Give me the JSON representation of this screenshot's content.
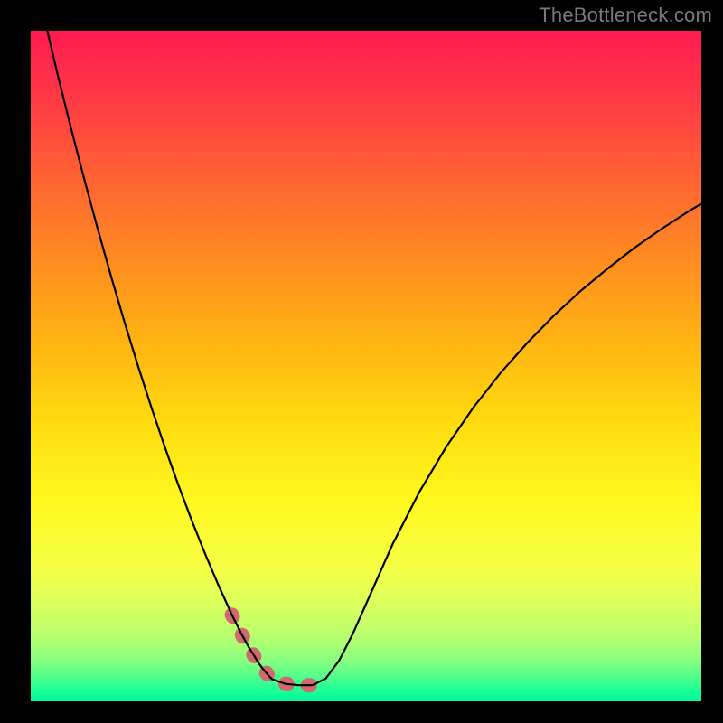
{
  "watermark": "TheBottleneck.com",
  "chart_data": {
    "type": "line",
    "title": "",
    "xlabel": "",
    "ylabel": "",
    "xlim": [
      0,
      1
    ],
    "ylim": [
      0,
      1
    ],
    "x": [
      0.0,
      0.02,
      0.04,
      0.06,
      0.08,
      0.1,
      0.12,
      0.14,
      0.16,
      0.18,
      0.2,
      0.22,
      0.24,
      0.26,
      0.28,
      0.3,
      0.305,
      0.31,
      0.315,
      0.32,
      0.325,
      0.33,
      0.335,
      0.34,
      0.345,
      0.35,
      0.355,
      0.36,
      0.38,
      0.4,
      0.42,
      0.44,
      0.46,
      0.48,
      0.5,
      0.54,
      0.58,
      0.62,
      0.66,
      0.7,
      0.74,
      0.78,
      0.82,
      0.86,
      0.9,
      0.94,
      0.98,
      1.0
    ],
    "y": [
      1.11,
      1.02,
      0.935,
      0.855,
      0.778,
      0.704,
      0.633,
      0.565,
      0.5,
      0.438,
      0.379,
      0.323,
      0.27,
      0.22,
      0.173,
      0.129,
      0.119,
      0.109,
      0.099,
      0.09,
      0.081,
      0.073,
      0.065,
      0.057,
      0.05,
      0.044,
      0.038,
      0.033,
      0.026,
      0.024,
      0.024,
      0.034,
      0.061,
      0.1,
      0.145,
      0.235,
      0.313,
      0.38,
      0.438,
      0.489,
      0.534,
      0.575,
      0.612,
      0.645,
      0.676,
      0.704,
      0.73,
      0.742
    ],
    "highlight_range": {
      "x_start": 0.3,
      "x_end": 0.44,
      "y_max": 0.13
    },
    "gradient_stops": [
      {
        "pos": 0.0,
        "color": "#ff1b50"
      },
      {
        "pos": 0.06,
        "color": "#ff2c4b"
      },
      {
        "pos": 0.14,
        "color": "#ff4640"
      },
      {
        "pos": 0.24,
        "color": "#ff6a30"
      },
      {
        "pos": 0.35,
        "color": "#ff8f20"
      },
      {
        "pos": 0.47,
        "color": "#ffb612"
      },
      {
        "pos": 0.59,
        "color": "#ffdd10"
      },
      {
        "pos": 0.7,
        "color": "#fff81f"
      },
      {
        "pos": 0.8,
        "color": "#f6ff45"
      },
      {
        "pos": 0.86,
        "color": "#d9ff5f"
      },
      {
        "pos": 0.905,
        "color": "#b6ff70"
      },
      {
        "pos": 0.94,
        "color": "#86ff7e"
      },
      {
        "pos": 0.965,
        "color": "#4dff8c"
      },
      {
        "pos": 0.985,
        "color": "#18ff97"
      },
      {
        "pos": 1.0,
        "color": "#00f89b"
      }
    ],
    "highlight_color": "#d06a6e",
    "curve_colors": {
      "stroke": "#000000"
    }
  }
}
